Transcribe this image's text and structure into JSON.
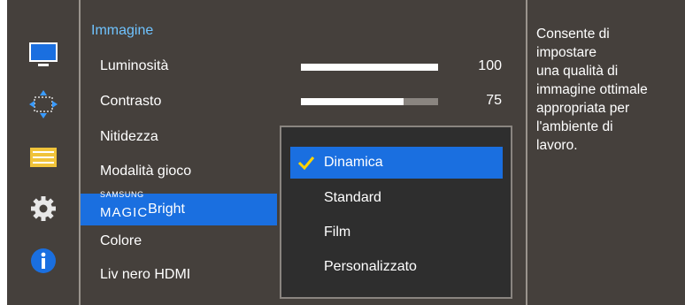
{
  "menu": {
    "title": "Immagine",
    "items": [
      {
        "label": "Luminosità",
        "value": "100",
        "bar_level": 1.0
      },
      {
        "label": "Contrasto",
        "value": "75",
        "bar_level": 0.75
      },
      {
        "label": "Nitidezza"
      },
      {
        "label": "Modalità gioco"
      },
      {
        "label_prefix_small": "SAMSUNG",
        "label_prefix": "MAGIC",
        "label": "Bright",
        "selected": true
      },
      {
        "label": "Colore"
      },
      {
        "label": "Liv nero HDMI"
      }
    ]
  },
  "dropdown": {
    "options": [
      {
        "label": "Dinamica",
        "selected": true
      },
      {
        "label": "Standard"
      },
      {
        "label": "Film"
      },
      {
        "label": "Personalizzato"
      }
    ]
  },
  "help": {
    "text_lines": [
      "Consente di",
      "impostare",
      "una qualità di",
      "immagine ottimale",
      "appropriata per",
      "l'ambiente di",
      "lavoro."
    ]
  },
  "rail": {
    "icons": [
      "monitor-icon",
      "arrows-icon",
      "panel-lines-icon",
      "gear-icon",
      "info-icon"
    ]
  },
  "colors": {
    "accent": "#1a6fe0",
    "title": "#6fc3ff",
    "background": "#45403c"
  }
}
